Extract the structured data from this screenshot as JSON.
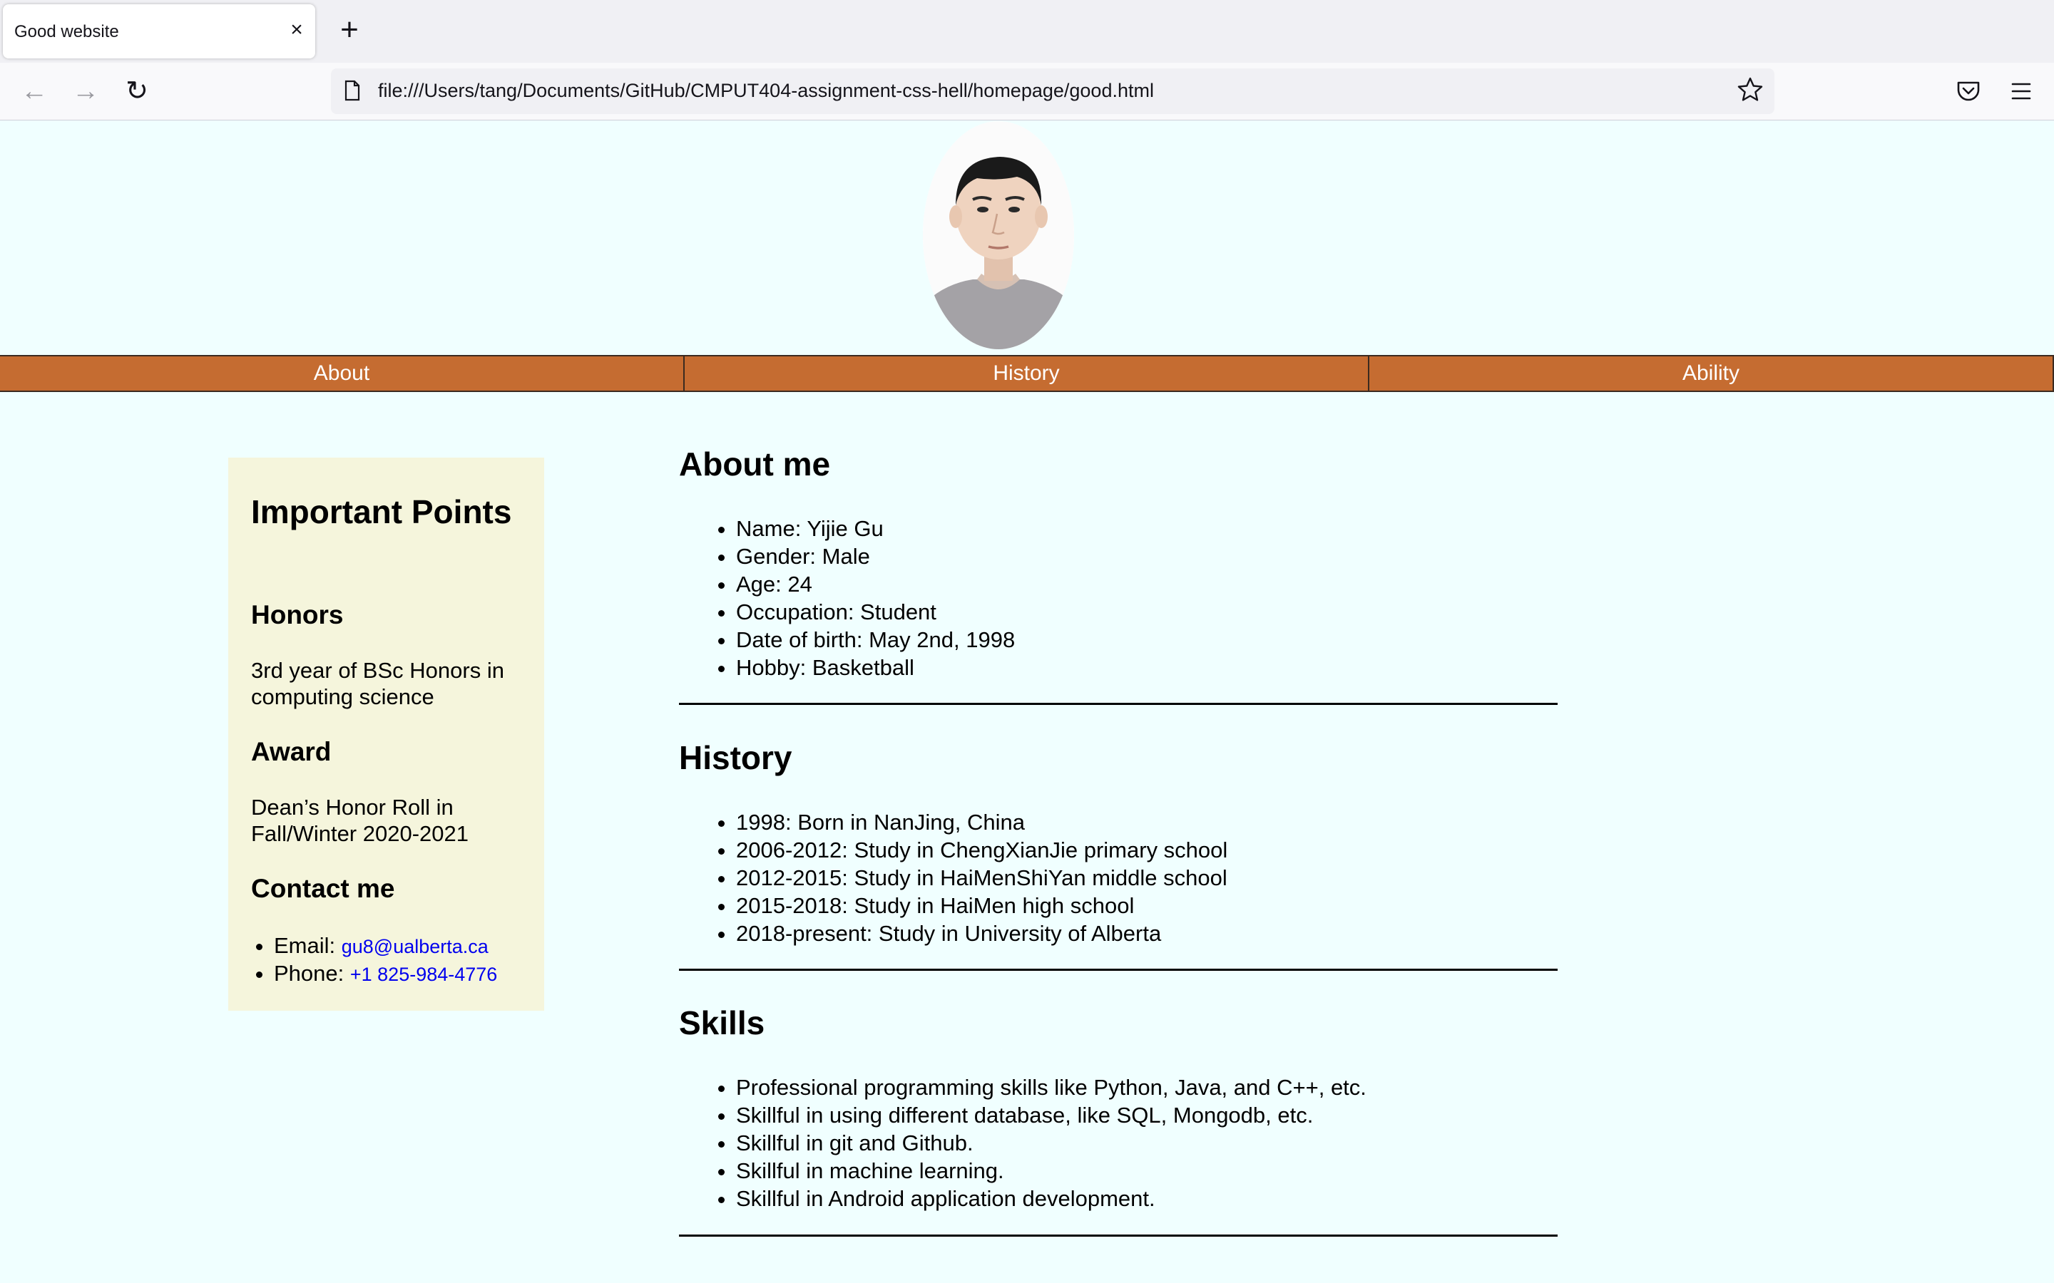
{
  "browser": {
    "tab_title": "Good website",
    "tab_close": "×",
    "new_tab": "+",
    "url": "file:///Users/tang/Documents/GitHub/CMPUT404-assignment-css-hell/homepage/good.html",
    "back": "←",
    "forward": "→",
    "reload": "↻"
  },
  "nav": {
    "items": [
      "About",
      "History",
      "Ability"
    ]
  },
  "sidebar": {
    "title": "Important Points",
    "honors_heading": "Honors",
    "honors_text": "3rd year of BSc Honors in computing science",
    "award_heading": "Award",
    "award_text": "Dean’s Honor Roll in Fall/Winter 2020-2021",
    "contact_heading": "Contact me",
    "contact": [
      {
        "label": "Email: ",
        "value": "gu8@ualberta.ca"
      },
      {
        "label": "Phone: ",
        "value": "+1 825-984-4776"
      }
    ]
  },
  "about": {
    "heading": "About me",
    "items": [
      "Name: Yijie Gu",
      "Gender: Male",
      "Age: 24",
      "Occupation: Student",
      "Date of birth: May 2nd, 1998",
      "Hobby: Basketball"
    ]
  },
  "history": {
    "heading": "History",
    "items": [
      "1998: Born in NanJing, China",
      "2006-2012: Study in ChengXianJie primary school",
      "2012-2015: Study in HaiMenShiYan middle school",
      "2015-2018: Study in HaiMen high school",
      "2018-present: Study in University of Alberta"
    ]
  },
  "skills": {
    "heading": "Skills",
    "items": [
      "Professional programming skills like Python, Java, and C++, etc.",
      "Skillful in using different database, like SQL, Mongodb, etc.",
      "Skillful in git and Github.",
      "Skillful in machine learning.",
      "Skillful in Android application development."
    ]
  },
  "colors": {
    "page_bg": "#f0ffff",
    "nav_bg": "#c56c31",
    "sidebar_bg": "#f5f5dc",
    "link": "#0000ee"
  }
}
